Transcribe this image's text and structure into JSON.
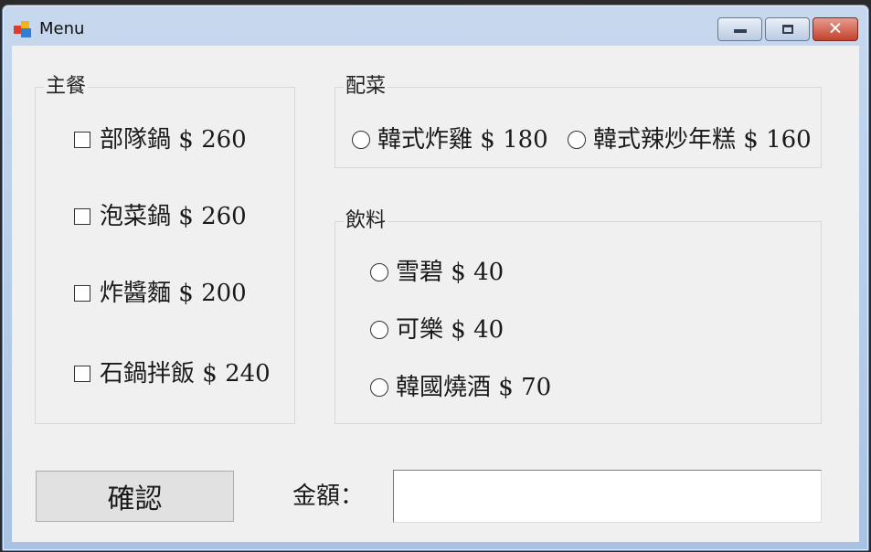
{
  "window": {
    "title": "Menu"
  },
  "main_course": {
    "legend": "主餐",
    "items": [
      {
        "label": "部隊鍋 $ 260",
        "checked": false
      },
      {
        "label": "泡菜鍋 $ 260",
        "checked": false
      },
      {
        "label": "炸醬麵 $ 200",
        "checked": false
      },
      {
        "label": "石鍋拌飯 $ 240",
        "checked": false
      }
    ]
  },
  "side_dish": {
    "legend": "配菜",
    "items": [
      {
        "label": "韓式炸雞 $ 180",
        "selected": false
      },
      {
        "label": "韓式辣炒年糕 $ 160",
        "selected": false
      }
    ]
  },
  "drinks": {
    "legend": "飲料",
    "items": [
      {
        "label": "雪碧 $ 40",
        "selected": false
      },
      {
        "label": "可樂 $ 40",
        "selected": false
      },
      {
        "label": "韓國燒酒 $ 70",
        "selected": false
      }
    ]
  },
  "confirm": {
    "label": "確認"
  },
  "amount": {
    "label": "金額：",
    "value": ""
  },
  "icons": {
    "app": "app-window-icon",
    "minimize": "minimize-icon",
    "maximize": "maximize-icon",
    "close": "close-icon"
  }
}
